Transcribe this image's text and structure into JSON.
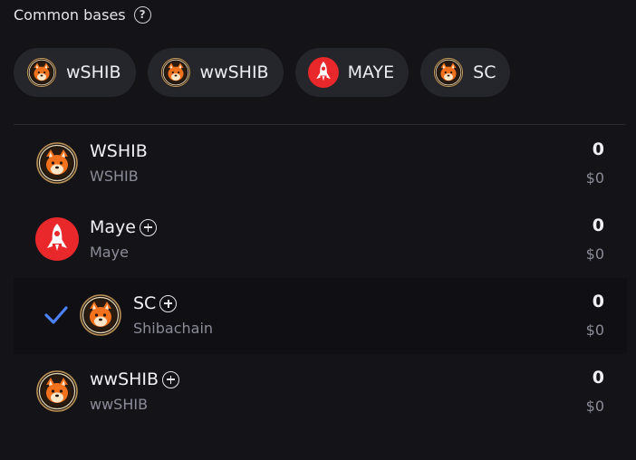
{
  "common_bases": {
    "title": "Common bases",
    "help_icon": "help-circle-icon",
    "chips": [
      {
        "label": "wSHIB",
        "icon": "shib-logo-icon"
      },
      {
        "label": "wwSHIB",
        "icon": "shib-logo-icon"
      },
      {
        "label": "MAYE",
        "icon": "rocket-logo-icon"
      },
      {
        "label": "SC",
        "icon": "shib-logo-icon"
      }
    ]
  },
  "tokens": [
    {
      "symbol": "WSHIB",
      "name": "WSHIB",
      "balance": "0",
      "value": "$0",
      "icon": "shib-logo-icon",
      "can_add": false,
      "selected": false
    },
    {
      "symbol": "Maye",
      "name": "Maye",
      "balance": "0",
      "value": "$0",
      "icon": "rocket-logo-icon",
      "can_add": true,
      "selected": false
    },
    {
      "symbol": "SC",
      "name": "Shibachain",
      "balance": "0",
      "value": "$0",
      "icon": "shib-logo-icon",
      "can_add": true,
      "selected": true
    },
    {
      "symbol": "wwSHIB",
      "name": "wwSHIB",
      "balance": "0",
      "value": "$0",
      "icon": "shib-logo-icon",
      "can_add": true,
      "selected": false
    }
  ],
  "colors": {
    "background": "#131318",
    "chip_bg": "#25252c",
    "check": "#4c82fb",
    "maye_red": "#e8282b"
  }
}
